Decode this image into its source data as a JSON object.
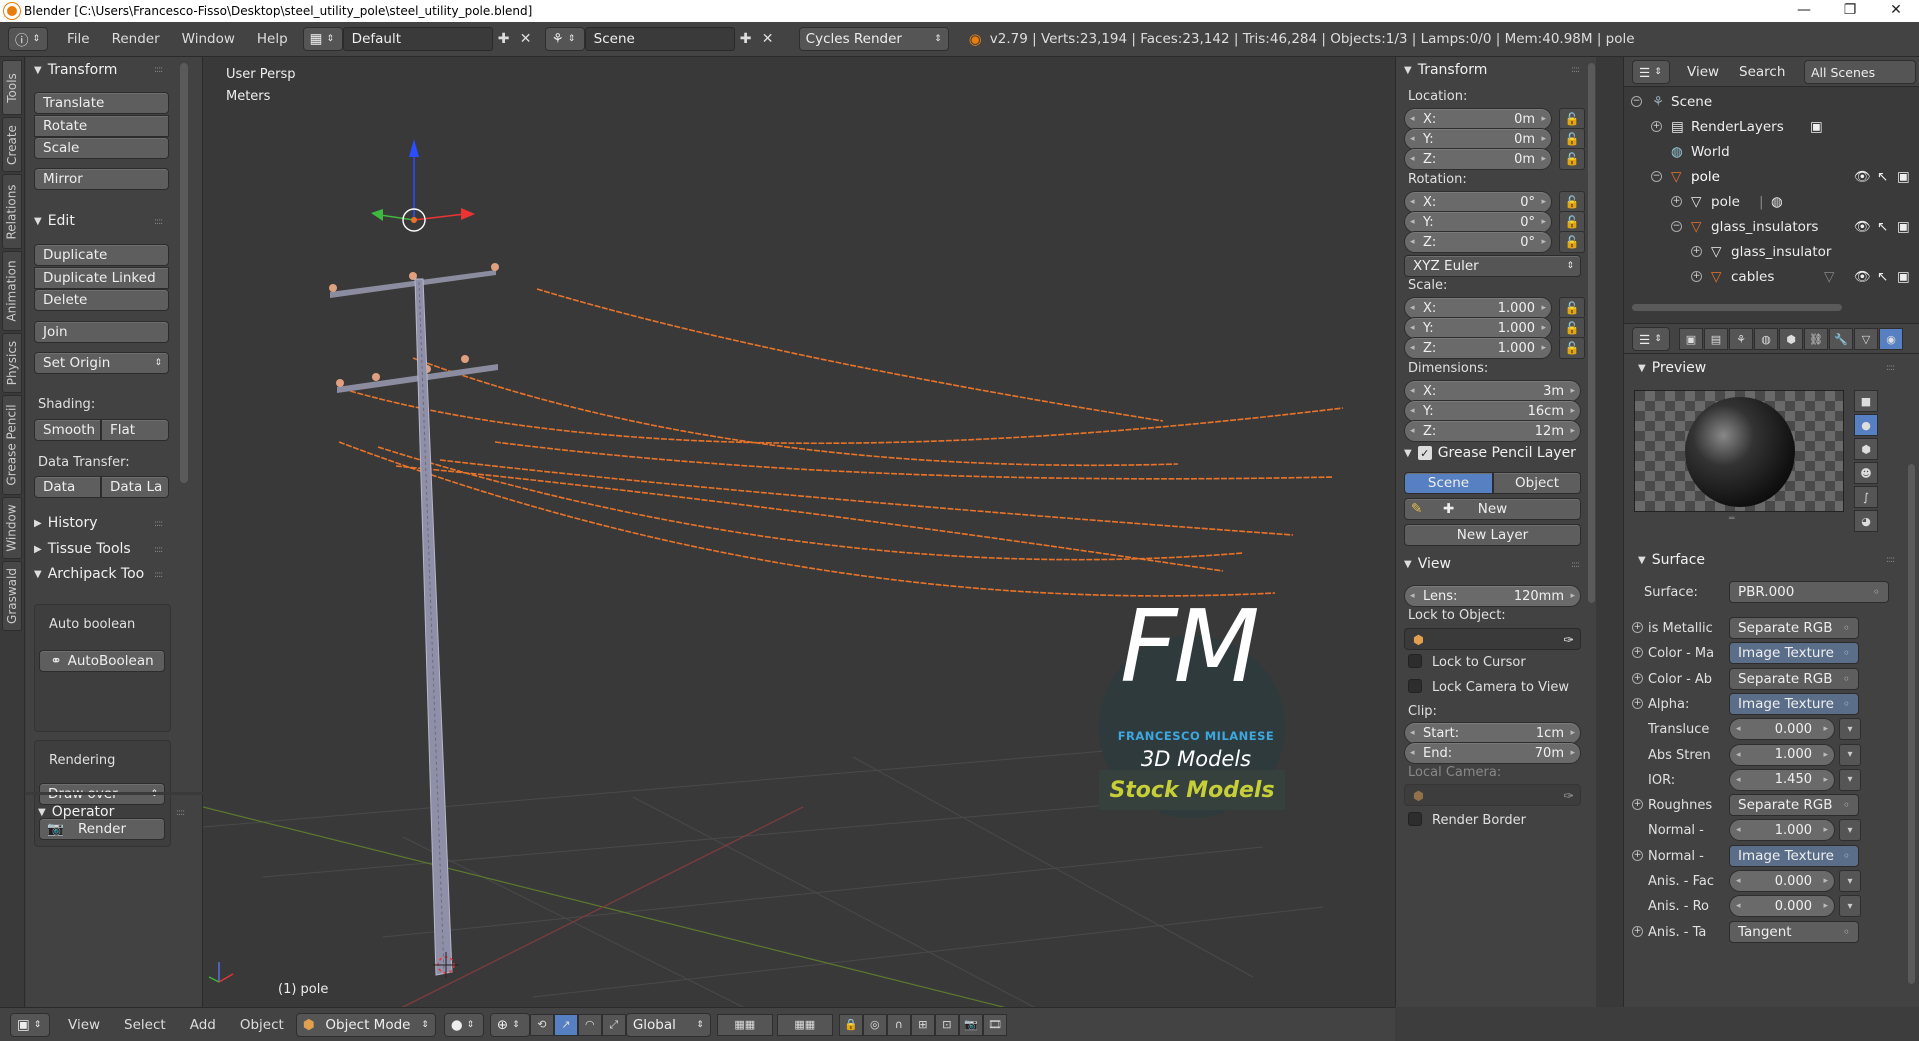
{
  "titlebar": {
    "title": "Blender [C:\\Users\\Francesco-Fisso\\Desktop\\steel_utility_pole\\steel_utility_pole.blend]"
  },
  "topbar": {
    "menus": [
      "File",
      "Render",
      "Window",
      "Help"
    ],
    "screen_layout": "Default",
    "scene": "Scene",
    "render_engine": "Cycles Render",
    "stats": "v2.79 | Verts:23,194 | Faces:23,142 | Tris:46,284 | Objects:1/3 | Lamps:0/0 | Mem:40.98M | pole"
  },
  "tabs": [
    "Tools",
    "Create",
    "Relations",
    "Animation",
    "Physics",
    "Grease Pencil",
    "Window",
    "Graswald"
  ],
  "toolshelf": {
    "transform_title": "Transform",
    "translate": "Translate",
    "rotate": "Rotate",
    "scale": "Scale",
    "mirror": "Mirror",
    "edit_title": "Edit",
    "duplicate": "Duplicate",
    "duplicate_linked": "Duplicate Linked",
    "delete": "Delete",
    "join": "Join",
    "set_origin": "Set Origin",
    "shading_label": "Shading:",
    "smooth": "Smooth",
    "flat": "Flat",
    "data_transfer_label": "Data Transfer:",
    "data": "Data",
    "data_la": "Data La",
    "history": "History",
    "tissue_tools": "Tissue Tools",
    "archipack": "Archipack Too",
    "auto_boolean_label": "Auto boolean",
    "autoboolean": "AutoBoolean",
    "rendering_label": "Rendering",
    "draw_over": "Draw over",
    "render": "Render",
    "operator": "Operator"
  },
  "viewport": {
    "view_name": "User Persp",
    "units": "Meters",
    "object_label": "(1) pole",
    "watermark": {
      "letters": "FM",
      "name": "FRANCESCO MILANESE",
      "sub": "3D Models",
      "tag": "Stock Models"
    }
  },
  "npanel": {
    "transform_title": "Transform",
    "location_label": "Location:",
    "location": {
      "x": "0m",
      "y": "0m",
      "z": "0m"
    },
    "rotation_label": "Rotation:",
    "rotation": {
      "x": "0°",
      "y": "0°",
      "z": "0°"
    },
    "rotation_mode": "XYZ Euler",
    "scale_label": "Scale:",
    "scale": {
      "x": "1.000",
      "y": "1.000",
      "z": "1.000"
    },
    "dimensions_label": "Dimensions:",
    "dimensions": {
      "x": "3m",
      "y": "16cm",
      "z": "12m"
    },
    "axis": {
      "x": "X:",
      "y": "Y:",
      "z": "Z:"
    },
    "grease_title": "Grease Pencil Layer",
    "gp_scene": "Scene",
    "gp_object": "Object",
    "gp_new": "New",
    "gp_new_layer": "New Layer",
    "view_title": "View",
    "lens_label": "Lens:",
    "lens_value": "120mm",
    "lock_object_label": "Lock to Object:",
    "lock_cursor": "Lock to Cursor",
    "lock_camera": "Lock Camera to View",
    "clip_label": "Clip:",
    "clip_start_label": "Start:",
    "clip_start": "1cm",
    "clip_end_label": "End:",
    "clip_end": "70m",
    "local_camera": "Local Camera:",
    "render_border": "Render Border"
  },
  "outliner": {
    "view": "View",
    "search": "Search",
    "filter": "All Scenes",
    "items": [
      "Scene",
      "RenderLayers",
      "World",
      "pole",
      "pole",
      "glass_insulators",
      "glass_insulator",
      "cables"
    ]
  },
  "properties": {
    "preview_title": "Preview",
    "surface_title": "Surface",
    "surface_label": "Surface:",
    "surface_value": "PBR.000",
    "rows": [
      {
        "label": "is Metallic",
        "value": "Separate RGB",
        "kind": "link"
      },
      {
        "label": "Color - Ma",
        "value": "Image Texture",
        "kind": "link"
      },
      {
        "label": "Color - Ab",
        "value": "Separate RGB",
        "kind": "link"
      },
      {
        "label": "Alpha:",
        "value": "Image Texture",
        "kind": "link"
      },
      {
        "label": "Transluce",
        "value": "0.000",
        "kind": "num"
      },
      {
        "label": "Abs Stren",
        "value": "1.000",
        "kind": "num"
      },
      {
        "label": "IOR:",
        "value": "1.450",
        "kind": "num"
      },
      {
        "label": "Roughnes",
        "value": "Separate RGB",
        "kind": "link"
      },
      {
        "label": "Normal -",
        "value": "1.000",
        "kind": "num"
      },
      {
        "label": "Normal -",
        "value": "Image Texture",
        "kind": "link"
      },
      {
        "label": "Anis. - Fac",
        "value": "0.000",
        "kind": "num"
      },
      {
        "label": "Anis. - Ro",
        "value": "0.000",
        "kind": "num"
      },
      {
        "label": "Anis. - Ta",
        "value": "Tangent",
        "kind": "link"
      }
    ]
  },
  "bottombar": {
    "menus": [
      "View",
      "Select",
      "Add",
      "Object"
    ],
    "mode": "Object Mode",
    "orientation": "Global"
  },
  "colors": {
    "accent_blue": "#5680c2",
    "cable_orange": "#e8742a",
    "background": "#393939"
  }
}
